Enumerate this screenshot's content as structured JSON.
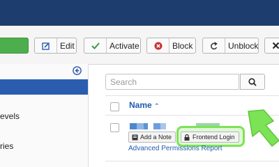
{
  "toolbar": {
    "edit_label": "Edit",
    "activate_label": "Activate",
    "block_label": "Block",
    "unblock_label": "Unblock"
  },
  "sidebar": {
    "items": [
      {
        "label": "evels"
      },
      {
        "label": "ries"
      }
    ]
  },
  "search": {
    "placeholder": "Search"
  },
  "table": {
    "name_header": "Name",
    "sort_indicator": "⌃"
  },
  "row": {
    "add_note_label": "Add a Note",
    "frontend_login_label": "Frontend Login",
    "advanced_report_label": "Advanced Permissions Report"
  },
  "colors": {
    "topbar": "#1c3d6e",
    "accent": "#2a5db0",
    "highlight": "#7de356",
    "success": "#4cae4c"
  },
  "icons": [
    "edit-icon",
    "check-icon",
    "block-icon",
    "undo-icon",
    "close-icon",
    "search-icon",
    "lock-icon",
    "collapse-icon",
    "pointer-arrow"
  ]
}
